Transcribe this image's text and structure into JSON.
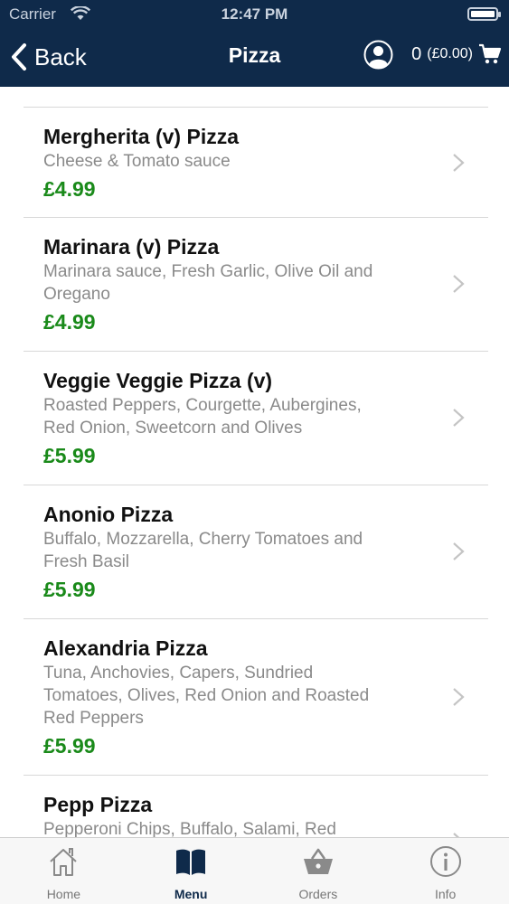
{
  "status_bar": {
    "carrier": "Carrier",
    "time": "12:47 PM"
  },
  "nav": {
    "back_label": "Back",
    "title": "Pizza",
    "cart_count": "0",
    "cart_total": "(£0.00)"
  },
  "colors": {
    "nav_bg": "#0f2a4a",
    "price": "#1a8a1a",
    "active_tab": "#0f2a4a"
  },
  "items": [
    {
      "name": "Mergherita (v) Pizza",
      "desc": [
        "Cheese & Tomato sauce"
      ],
      "price": "£4.99"
    },
    {
      "name": "Marinara (v) Pizza",
      "desc": [
        "Marinara sauce, Fresh Garlic, Olive Oil and",
        "Oregano"
      ],
      "price": "£4.99"
    },
    {
      "name": "Veggie Veggie Pizza (v)",
      "desc": [
        "Roasted Peppers, Courgette, Aubergines,",
        "Red Onion, Sweetcorn and Olives"
      ],
      "price": "£5.99"
    },
    {
      "name": "Anonio Pizza",
      "desc": [
        "Buffalo, Mozzarella, Cherry Tomatoes and",
        "Fresh Basil"
      ],
      "price": "£5.99"
    },
    {
      "name": "Alexandria Pizza",
      "desc": [
        "Tuna, Anchovies, Capers, Sundried",
        "Tomatoes, Olives, Red Onion and Roasted",
        "Red Peppers"
      ],
      "price": "£5.99"
    },
    {
      "name": "Pepp Pizza",
      "desc": [
        "Pepperoni Chips, Buffalo, Salami, Red"
      ],
      "price": ""
    }
  ],
  "tabs": [
    {
      "label": "Home",
      "icon": "home-icon",
      "active": false
    },
    {
      "label": "Menu",
      "icon": "book-icon",
      "active": true
    },
    {
      "label": "Orders",
      "icon": "basket-icon",
      "active": false
    },
    {
      "label": "Info",
      "icon": "info-icon",
      "active": false
    }
  ]
}
